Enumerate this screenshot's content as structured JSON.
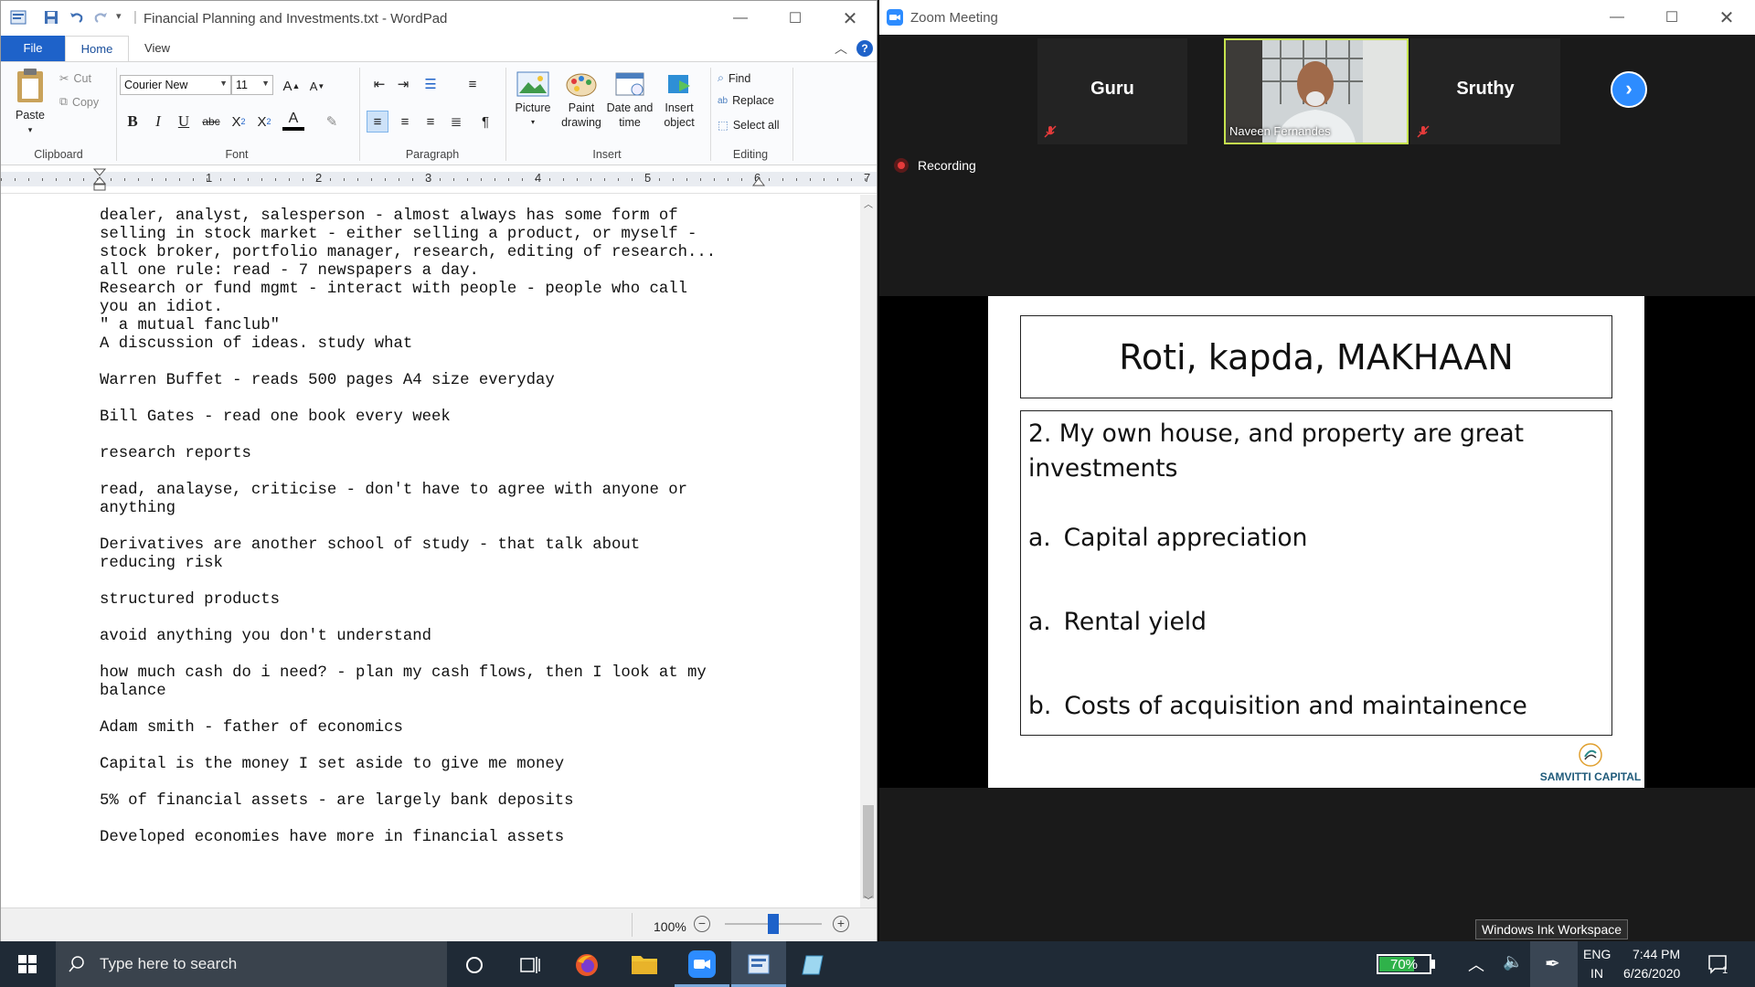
{
  "wordpad": {
    "title": "Financial Planning and Investments.txt - WordPad",
    "tabs": {
      "file": "File",
      "home": "Home",
      "view": "View"
    },
    "clipboard": {
      "paste": "Paste",
      "cut": "Cut",
      "copy": "Copy",
      "label": "Clipboard"
    },
    "font": {
      "family": "Courier New",
      "size": "11",
      "label": "Font"
    },
    "paragraph": {
      "label": "Paragraph"
    },
    "insert": {
      "picture": "Picture",
      "paint1": "Paint",
      "paint2": "drawing",
      "date1": "Date and",
      "date2": "time",
      "object1": "Insert",
      "object2": "object",
      "label": "Insert"
    },
    "editing": {
      "find": "Find",
      "replace": "Replace",
      "select_all": "Select all",
      "label": "Editing"
    },
    "ruler_numbers": [
      "1",
      "2",
      "3",
      "4",
      "5",
      "6",
      "7"
    ],
    "document_text": "dealer, analyst, salesperson - almost always has some form of\nselling in stock market - either selling a product, or myself -\nstock broker, portfolio manager, research, editing of research...\nall one rule: read - 7 newspapers a day.\nResearch or fund mgmt - interact with people - people who call\nyou an idiot.\n\" a mutual fanclub\"\nA discussion of ideas. study what\n\nWarren Buffet - reads 500 pages A4 size everyday\n\nBill Gates - read one book every week\n\nresearch reports\n\nread, analayse, criticise - don't have to agree with anyone or\nanything\n\nDerivatives are another school of study - that talk about\nreducing risk\n\nstructured products\n\navoid anything you don't understand\n\nhow much cash do i need? - plan my cash flows, then I look at my\nbalance\n\nAdam smith - father of economics\n\nCapital is the money I set aside to give me money\n\n5% of financial assets - are largely bank deposits\n\nDeveloped economies have more in financial assets",
    "zoom_level": "100%",
    "zoom_fraction": 0.5
  },
  "zoom": {
    "title": "Zoom Meeting",
    "participants": [
      {
        "name": "Guru",
        "muted": true
      },
      {
        "name": "Naveen Fernandes",
        "muted": false
      },
      {
        "name": "Sruthy",
        "muted": true
      }
    ],
    "recording_label": "Recording",
    "slide": {
      "title": "Roti, kapda, MAKHAAN",
      "heading": "2. My own house, and property are great investments",
      "items": [
        {
          "marker": "a.",
          "text": "Capital appreciation"
        },
        {
          "marker": "a.",
          "text": "Rental yield"
        },
        {
          "marker": "b.",
          "text": "Costs of acquisition and maintainence"
        }
      ],
      "logo_text": "SAMVITTI CAPITAL"
    }
  },
  "tooltip": "Windows Ink Workspace",
  "taskbar": {
    "search_placeholder": "Type here to search",
    "battery": "70%",
    "lang1": "ENG",
    "lang2": "IN",
    "time": "7:44 PM",
    "date": "6/26/2020",
    "notification_count": "1"
  },
  "colors": {
    "accent": "#1e62c9",
    "zoom_blue": "#2d8cff",
    "battery_green": "#2fb24a",
    "taskbar": "#1f2a36"
  }
}
